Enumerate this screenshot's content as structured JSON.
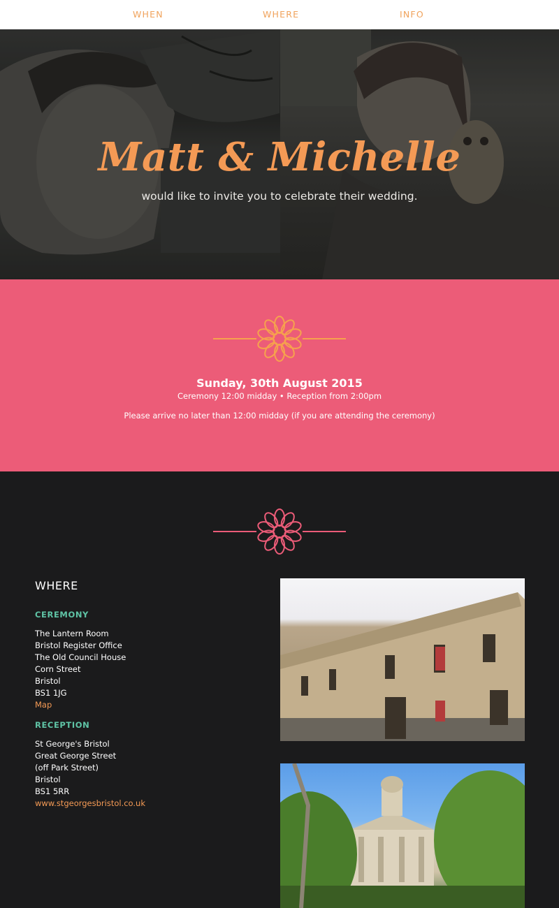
{
  "nav": {
    "items": [
      "WHEN",
      "WHERE",
      "INFO"
    ]
  },
  "hero": {
    "title": "Matt & Michelle",
    "subtitle": "would like to invite you to celebrate their wedding."
  },
  "when": {
    "date": "Sunday, 30th August 2015",
    "times": "Ceremony 12:00 midday • Reception from 2:00pm",
    "note": "Please arrive no later than 12:00 midday (if you are attending the ceremony)"
  },
  "where": {
    "title": "WHERE",
    "ceremony": {
      "label": "CEREMONY",
      "lines": [
        "The Lantern Room",
        "Bristol Register Office",
        "The Old Council House",
        "Corn Street",
        "Bristol",
        "BS1 1JG"
      ],
      "link": "Map"
    },
    "reception": {
      "label": "RECEPTION",
      "lines": [
        "St George's Bristol",
        "Great George Street",
        "(off Park Street)",
        "Bristol",
        "BS1 5RR"
      ],
      "link": "www.stgeorgesbristol.co.uk"
    }
  },
  "colors": {
    "accent_orange": "#f49a55",
    "pink_band": "#ec5c78",
    "dark_bg": "#1b1b1c",
    "teal_label": "#5fc4a6"
  },
  "icons": {
    "divider_flower": "flower-icon"
  }
}
